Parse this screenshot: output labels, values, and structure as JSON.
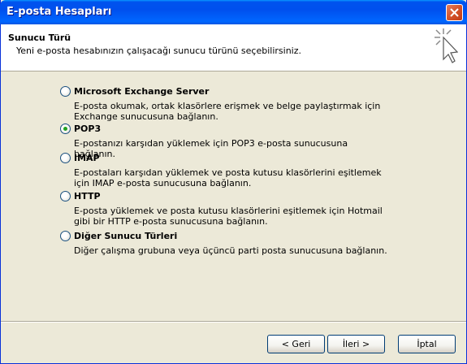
{
  "window": {
    "title": "E-posta Hesapları"
  },
  "header": {
    "title": "Sunucu Türü",
    "subtitle": "Yeni e-posta hesabınızın çalışacağı sunucu türünü seçebilirsiniz."
  },
  "options": [
    {
      "label": "Microsoft Exchange Server",
      "description": "E-posta okumak, ortak klasörlere erişmek ve belge paylaştırmak için Exchange sunucusuna bağlanın.",
      "checked": false
    },
    {
      "label": "POP3",
      "description": "E-postanızı karşıdan yüklemek için POP3 e-posta sunucusuna bağlanın.",
      "checked": true
    },
    {
      "label": "IMAP",
      "description": "E-postaları karşıdan yüklemek ve posta kutusu klasörlerini eşitlemek için IMAP e-posta sunucusuna bağlanın.",
      "checked": false
    },
    {
      "label": "HTTP",
      "description": "E-posta yüklemek ve posta kutusu klasörlerini eşitlemek için Hotmail gibi bir HTTP e-posta sunucusuna bağlanın.",
      "checked": false
    },
    {
      "label": "Diğer Sunucu Türleri",
      "description": "Diğer çalışma grubuna veya üçüncü parti posta sunucusuna bağlanın.",
      "checked": false
    }
  ],
  "buttons": {
    "back": "< Geri",
    "next": "İleri >",
    "cancel": "İptal"
  }
}
